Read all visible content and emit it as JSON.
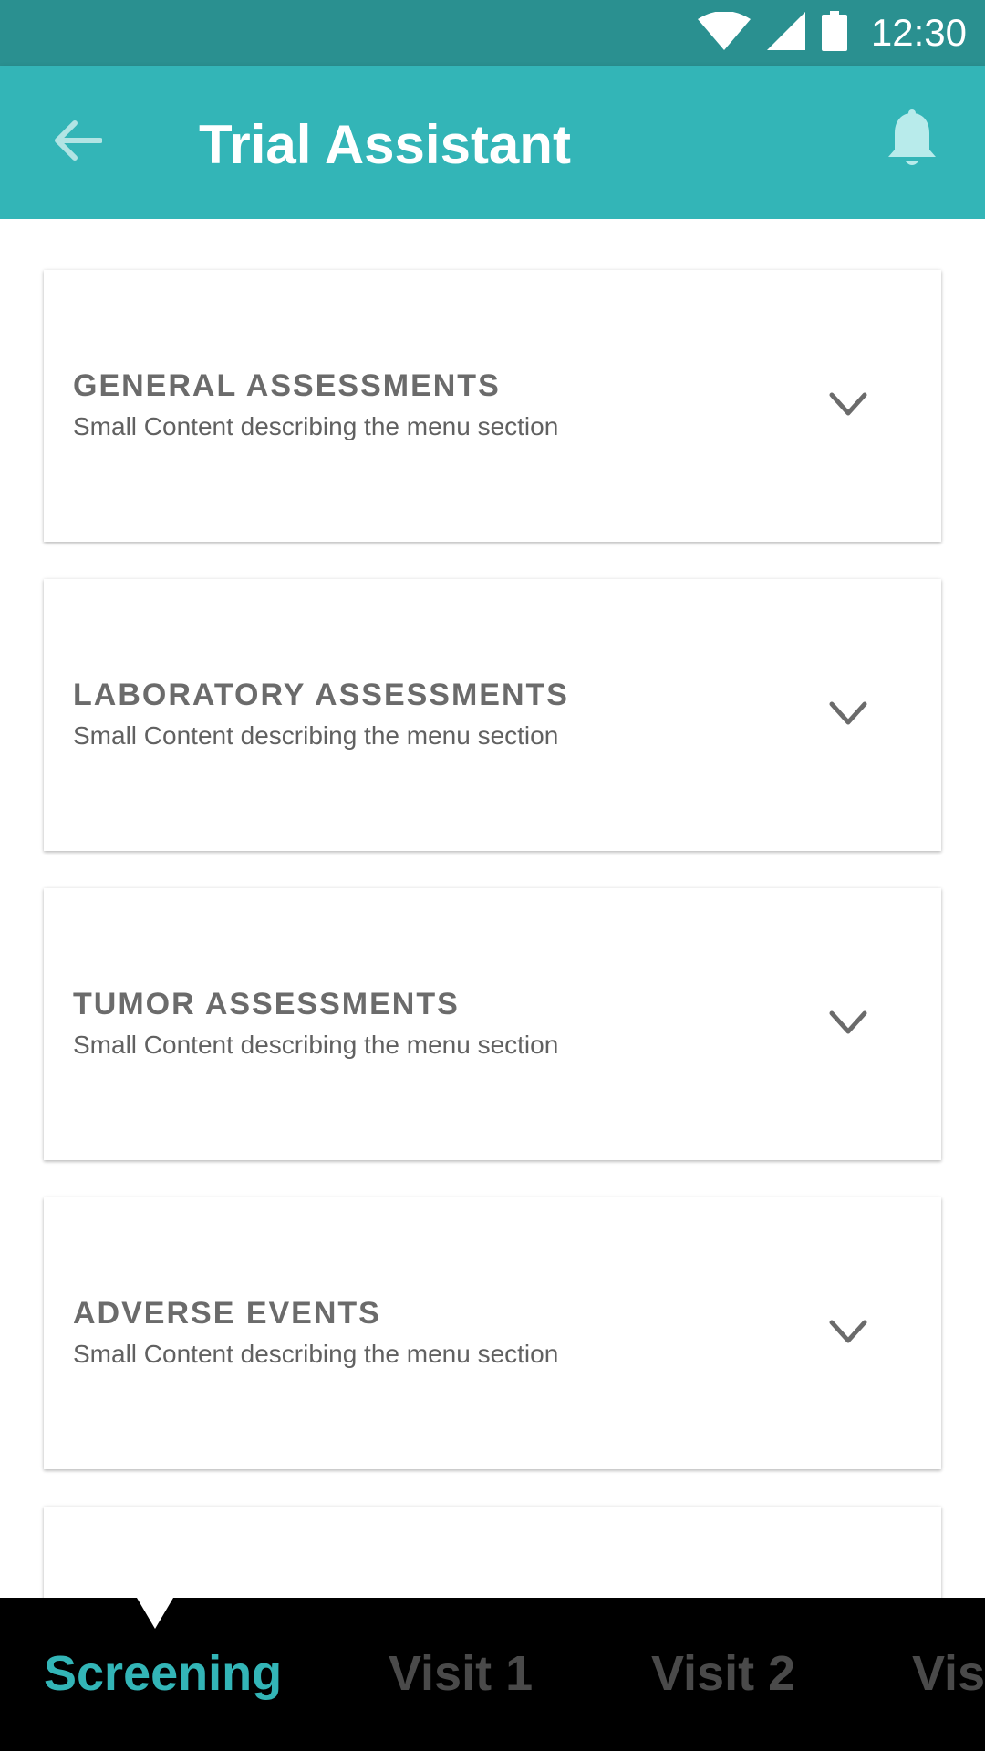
{
  "status_bar": {
    "time": "12:30",
    "icons": [
      "wifi-icon",
      "signal-icon",
      "battery-icon"
    ]
  },
  "app_bar": {
    "title": "Trial Assistant",
    "back_icon": "arrow-left-icon",
    "notification_icon": "bell-icon"
  },
  "sections": [
    {
      "title": "GENERAL ASSESSMENTS",
      "subtitle": "Small Content describing the menu section"
    },
    {
      "title": "LABORATORY ASSESSMENTS",
      "subtitle": "Small Content describing the menu section"
    },
    {
      "title": "TUMOR ASSESSMENTS",
      "subtitle": "Small Content describing the menu section"
    },
    {
      "title": "ADVERSE EVENTS",
      "subtitle": "Small Content describing the menu section"
    }
  ],
  "bottom_tabs": [
    {
      "label": "Screening",
      "active": true
    },
    {
      "label": "Visit 1",
      "active": false
    },
    {
      "label": "Visit 2",
      "active": false
    },
    {
      "label": "Vis",
      "active": false
    }
  ],
  "colors": {
    "status_bar": "#2a9090",
    "app_bar": "#33b5b7",
    "active_tab": "#33b5b7",
    "inactive_tab": "#4a4a4a",
    "bottom_bar": "#000000"
  }
}
